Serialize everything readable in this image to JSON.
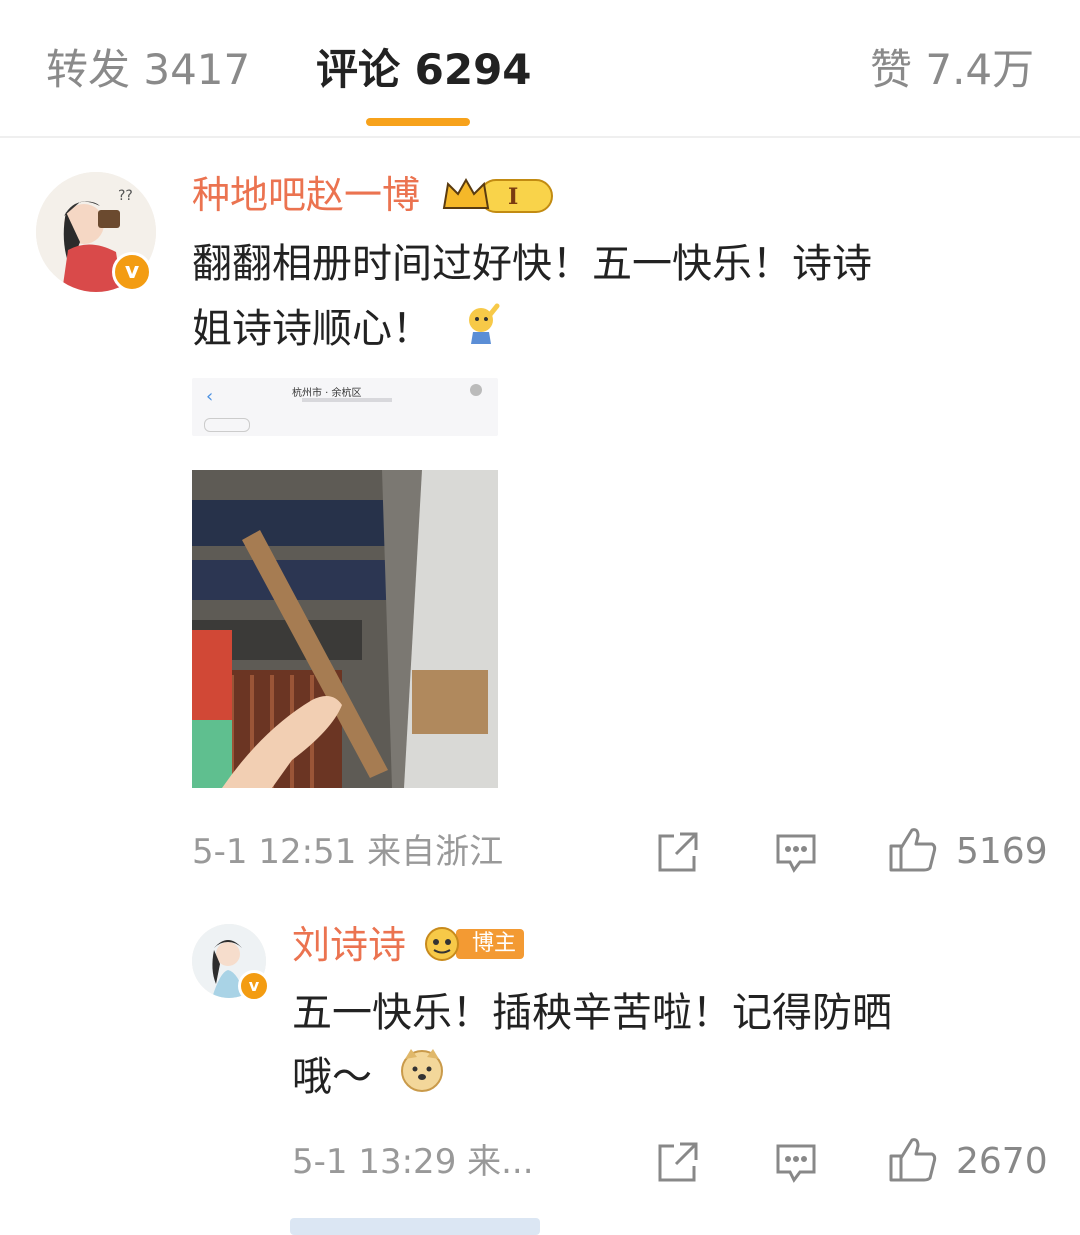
{
  "tabs": {
    "repost": "转发 3417",
    "comment": "评论 6294",
    "like": "赞 7.4万"
  },
  "colors": {
    "accent": "#f7a21b",
    "username": "#eb7350",
    "meta": "#999999"
  },
  "comment": {
    "username": "种地吧赵一博",
    "level_badge": "I",
    "text_line1": "翻翻相册时间过好快！五一快乐！诗诗",
    "text_line2": "姐诗诗顺心！",
    "attachment_header": "杭州市 · 余杭区",
    "meta": "5-1 12:51 来自浙江",
    "likes": "5169"
  },
  "reply": {
    "username": "刘诗诗",
    "badge": "博主",
    "text_line1": "五一快乐！插秧辛苦啦！记得防晒",
    "text_line2": "哦～",
    "meta": "5-1 13:29 来...",
    "likes": "2670"
  },
  "icons": [
    "share-icon",
    "comment-icon",
    "like-icon",
    "verified-icon",
    "crown-icon"
  ]
}
